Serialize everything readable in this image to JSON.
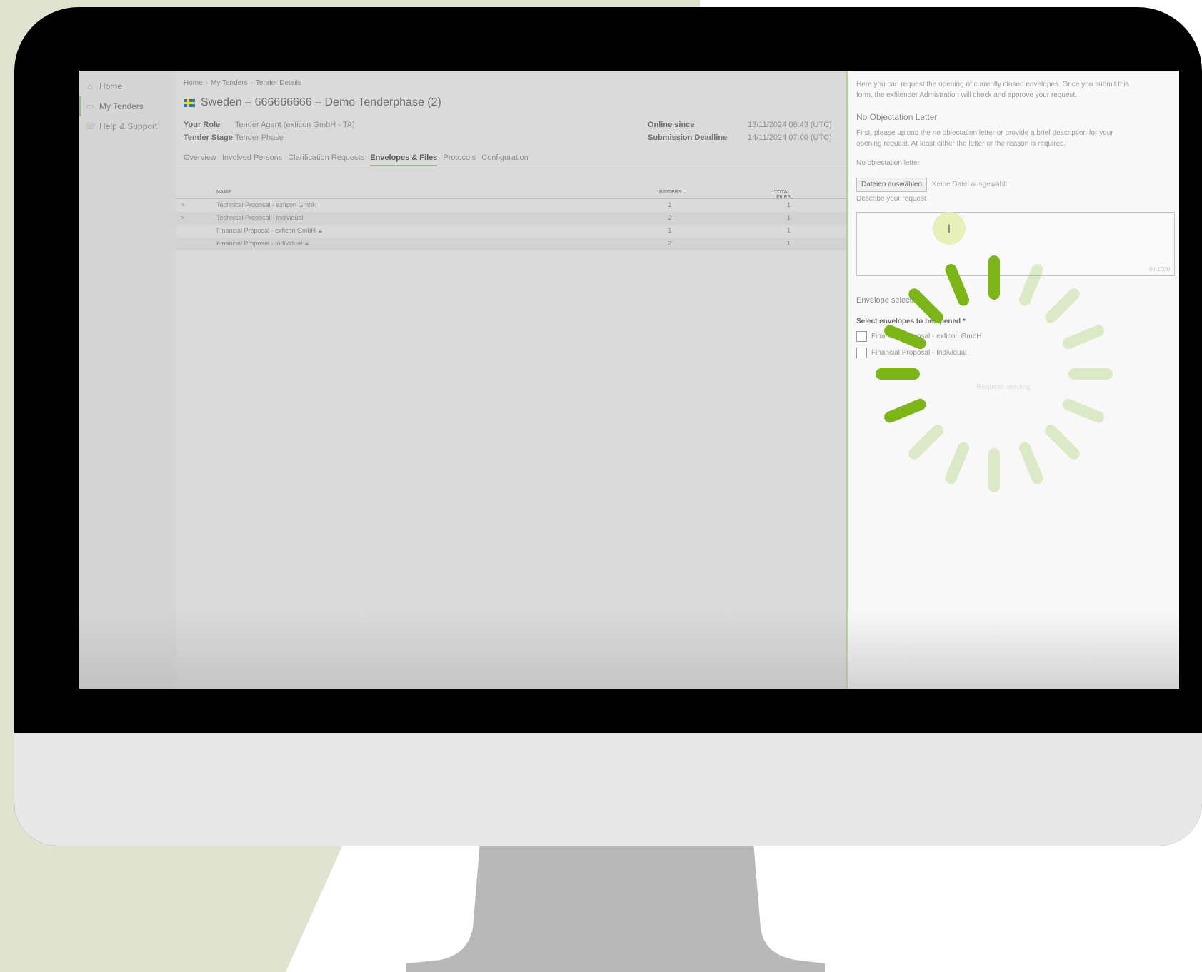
{
  "colors": {
    "bg_triangle": "#dfe3cf",
    "accent_green": "#7cb518",
    "monitor_frame": "#000000",
    "monitor_chin": "#e8e8e8",
    "stand": "#b8b8b8"
  },
  "sidebar": {
    "items": [
      {
        "label": "Home",
        "icon": "home-icon"
      },
      {
        "label": "My Tenders",
        "icon": "folder-icon"
      },
      {
        "label": "Help & Support",
        "icon": "chat-icon"
      }
    ]
  },
  "breadcrumb": [
    "Home",
    "My Tenders",
    "Tender Details"
  ],
  "page": {
    "title": "Sweden – 666666666 – Demo Tenderphase (2)",
    "your_role_label": "Your Role",
    "your_role_value": "Tender Agent (exficon GmbH - TA)",
    "tender_stage_label": "Tender Stage",
    "tender_stage_value": "Tender Phase",
    "online_since_label": "Online since",
    "online_since_value": "13/11/2024 08:43 (UTC)",
    "deadline_label": "Submission Deadline",
    "deadline_value": "14/11/2024 07:00 (UTC)"
  },
  "tabs": [
    "Overview",
    "Involved Persons",
    "Clarification Requests",
    "Envelopes & Files",
    "Protocols",
    "Configuration"
  ],
  "active_tab": "Envelopes & Files",
  "table": {
    "headers": {
      "name": "NAME",
      "bidders": "BIDDERS",
      "files": "TOTAL FILES"
    },
    "rows": [
      {
        "chevron": ">",
        "name": "Technical Proposal - exficon GmbH",
        "bidders": "1",
        "files": "1",
        "locked": false
      },
      {
        "chevron": ">",
        "name": "Technical Proposal - Individual",
        "bidders": "2",
        "files": "1",
        "locked": false
      },
      {
        "chevron": "",
        "name": "Financial Proposal - exficon GmbH",
        "bidders": "1",
        "files": "1",
        "locked": true
      },
      {
        "chevron": "",
        "name": "Financial Proposal - Individual",
        "bidders": "2",
        "files": "1",
        "locked": true
      }
    ]
  },
  "panel": {
    "intro_line1": "Here you can request the opening of currently closed envelopes. Once you submit this",
    "intro_line2": "form, the exfitender Admistration will check and approve your request.",
    "no_obj_heading": "No Objectation Letter",
    "no_obj_text1": "First, please upload the no objectation letter or provide a brief description for your",
    "no_obj_text2": "opening request. At least either the letter or the reason is required.",
    "file_label": "No objectation letter",
    "file_button": "Dateien auswählen",
    "file_status": "Keine Datei ausgewählt",
    "describe_label": "Describe your request",
    "char_counter": "0 / 1000",
    "cursor_glyph": "I",
    "envelope_heading": "Envelope selection",
    "select_label": "Select envelopes to be opened *",
    "envelopes": [
      "Financial Proposal - exficon GmbH",
      "Financial Proposal - Individual"
    ],
    "request_button": "Request opening"
  }
}
